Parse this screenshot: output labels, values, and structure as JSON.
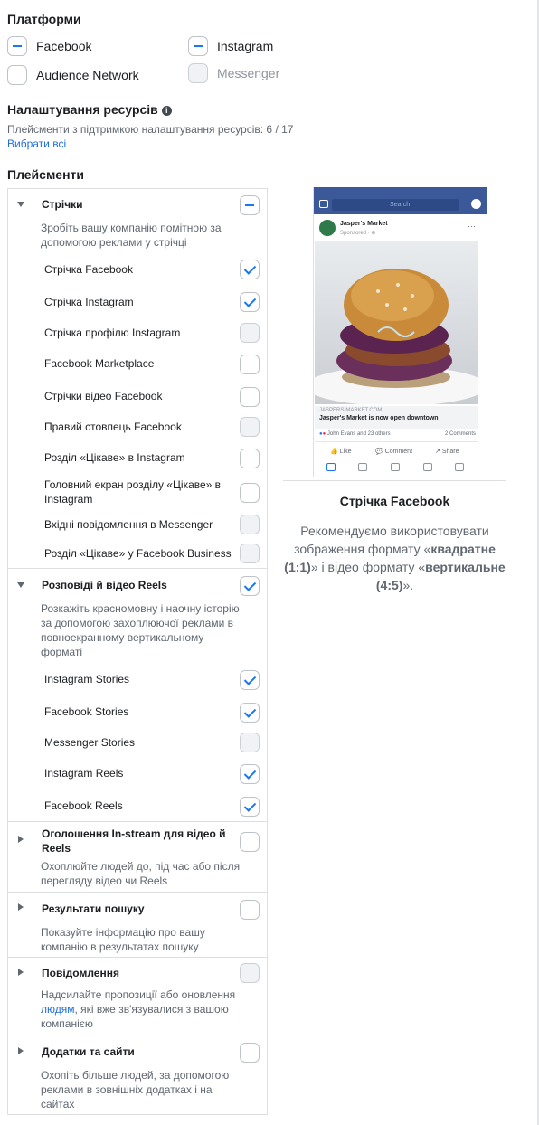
{
  "platforms": {
    "title": "Платформи",
    "items": [
      {
        "label": "Facebook",
        "state": "indeterminate"
      },
      {
        "label": "Instagram",
        "state": "indeterminate"
      },
      {
        "label": "Audience Network",
        "state": "unchecked"
      },
      {
        "label": "Messenger",
        "state": "disabled"
      }
    ]
  },
  "asset_customization": {
    "title": "Налаштування ресурсів",
    "info_icon": "info-icon",
    "subtitle": "Плейсменти з підтримкою налаштування ресурсів: 6 / 17",
    "select_all": "Вибрати всі"
  },
  "placements": {
    "title": "Плейсменти",
    "sections": [
      {
        "title": "Стрічки",
        "state": "indeterminate",
        "expanded": true,
        "description": "Зробіть вашу компанію помітною за допомогою реклами у стрічці",
        "items": [
          {
            "label": "Стрічка Facebook",
            "state": "checked"
          },
          {
            "label": "Стрічка Instagram",
            "state": "checked"
          },
          {
            "label": "Стрічка профілю Instagram",
            "state": "disabled"
          },
          {
            "label": "Facebook Marketplace",
            "state": "unchecked"
          },
          {
            "label": "Стрічки відео Facebook",
            "state": "unchecked"
          },
          {
            "label": "Правий стовпець Facebook",
            "state": "disabled"
          },
          {
            "label": "Розділ «Цікаве» в Instagram",
            "state": "unchecked"
          },
          {
            "label": "Головний екран розділу «Цікаве» в Instagram",
            "state": "unchecked"
          },
          {
            "label": "Вхідні повідомлення в Messenger",
            "state": "disabled"
          },
          {
            "label": "Розділ «Цікаве» у Facebook Business",
            "state": "disabled"
          }
        ]
      },
      {
        "title": "Розповіді й відео Reels",
        "state": "checked",
        "expanded": true,
        "description": "Розкажіть красномовну і наочну історію за допомогою захоплюючої реклами в повноекранному вертикальному форматі",
        "items": [
          {
            "label": "Instagram Stories",
            "state": "checked"
          },
          {
            "label": "Facebook Stories",
            "state": "checked"
          },
          {
            "label": "Messenger Stories",
            "state": "disabled"
          },
          {
            "label": "Instagram Reels",
            "state": "checked"
          },
          {
            "label": "Facebook Reels",
            "state": "checked"
          }
        ]
      },
      {
        "title": "Оголошення In-stream для відео й Reels",
        "state": "unchecked",
        "expanded": false,
        "description": "Охоплюйте людей до, під час або після перегляду відео чи Reels"
      },
      {
        "title": "Результати пошуку",
        "state": "unchecked",
        "expanded": false,
        "description": "Показуйте інформацію про вашу компанію в результатах пошуку"
      },
      {
        "title": "Повідомлення",
        "state": "disabled",
        "expanded": false,
        "description_before_link": "Надсилайте пропозиції або оновлення ",
        "description_link": "людям",
        "description_after_link": ", які вже зв'язувалися з вашою компанією"
      },
      {
        "title": "Додатки та сайти",
        "state": "unchecked",
        "expanded": false,
        "description": "Охопіть більше людей, за допомогою реклами в зовнішніх додатках і на сайтах"
      }
    ]
  },
  "preview": {
    "mockup": {
      "search_placeholder": "Search",
      "page_name": "Jasper's Market",
      "sponsored": "Sponsored · ⊕",
      "menu": "···",
      "domain": "JASPERS-MARKET.COM",
      "headline": "Jasper's Market is now open downtown",
      "reactions": "John Evans and 23 others",
      "comments": "2 Comments",
      "actions": [
        "Like",
        "Comment",
        "Share"
      ],
      "brand_color": "#3b5998"
    },
    "title": "Стрічка Facebook",
    "desc_1": "Рекомендуємо використовувати зображення формату «",
    "desc_bold_1": "квадратне (1:1)",
    "desc_2": "» і відео формату «",
    "desc_bold_2": "вертикальне (4:5)",
    "desc_3": "»."
  },
  "colors": {
    "accent": "#1877f2",
    "link": "#216fdb"
  }
}
